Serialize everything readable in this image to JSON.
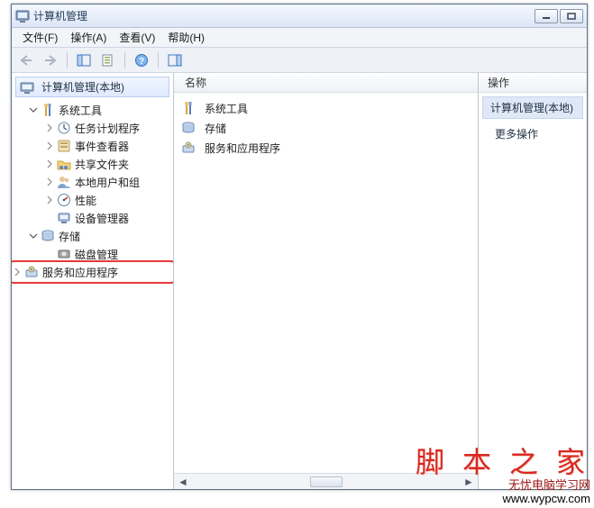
{
  "title": "计算机管理",
  "menu": {
    "file": "文件(F)",
    "action": "操作(A)",
    "view": "查看(V)",
    "help": "帮助(H)"
  },
  "tree": {
    "root": "计算机管理(本地)",
    "system_tools": "系统工具",
    "task_scheduler": "任务计划程序",
    "event_viewer": "事件查看器",
    "shared_folders": "共享文件夹",
    "local_users": "本地用户和组",
    "performance": "性能",
    "device_manager": "设备管理器",
    "storage": "存储",
    "disk_management": "磁盘管理",
    "services_apps": "服务和应用程序"
  },
  "content": {
    "column_header": "名称",
    "rows": {
      "system_tools": "系统工具",
      "storage": "存储",
      "services_apps": "服务和应用程序"
    }
  },
  "actions": {
    "title": "操作",
    "highlight": "计算机管理(本地)",
    "more": "更多操作"
  },
  "watermark": {
    "brand": "脚 本 之 家",
    "cn": "无忧电脑学习网",
    "url": "www.wypcw.com"
  }
}
